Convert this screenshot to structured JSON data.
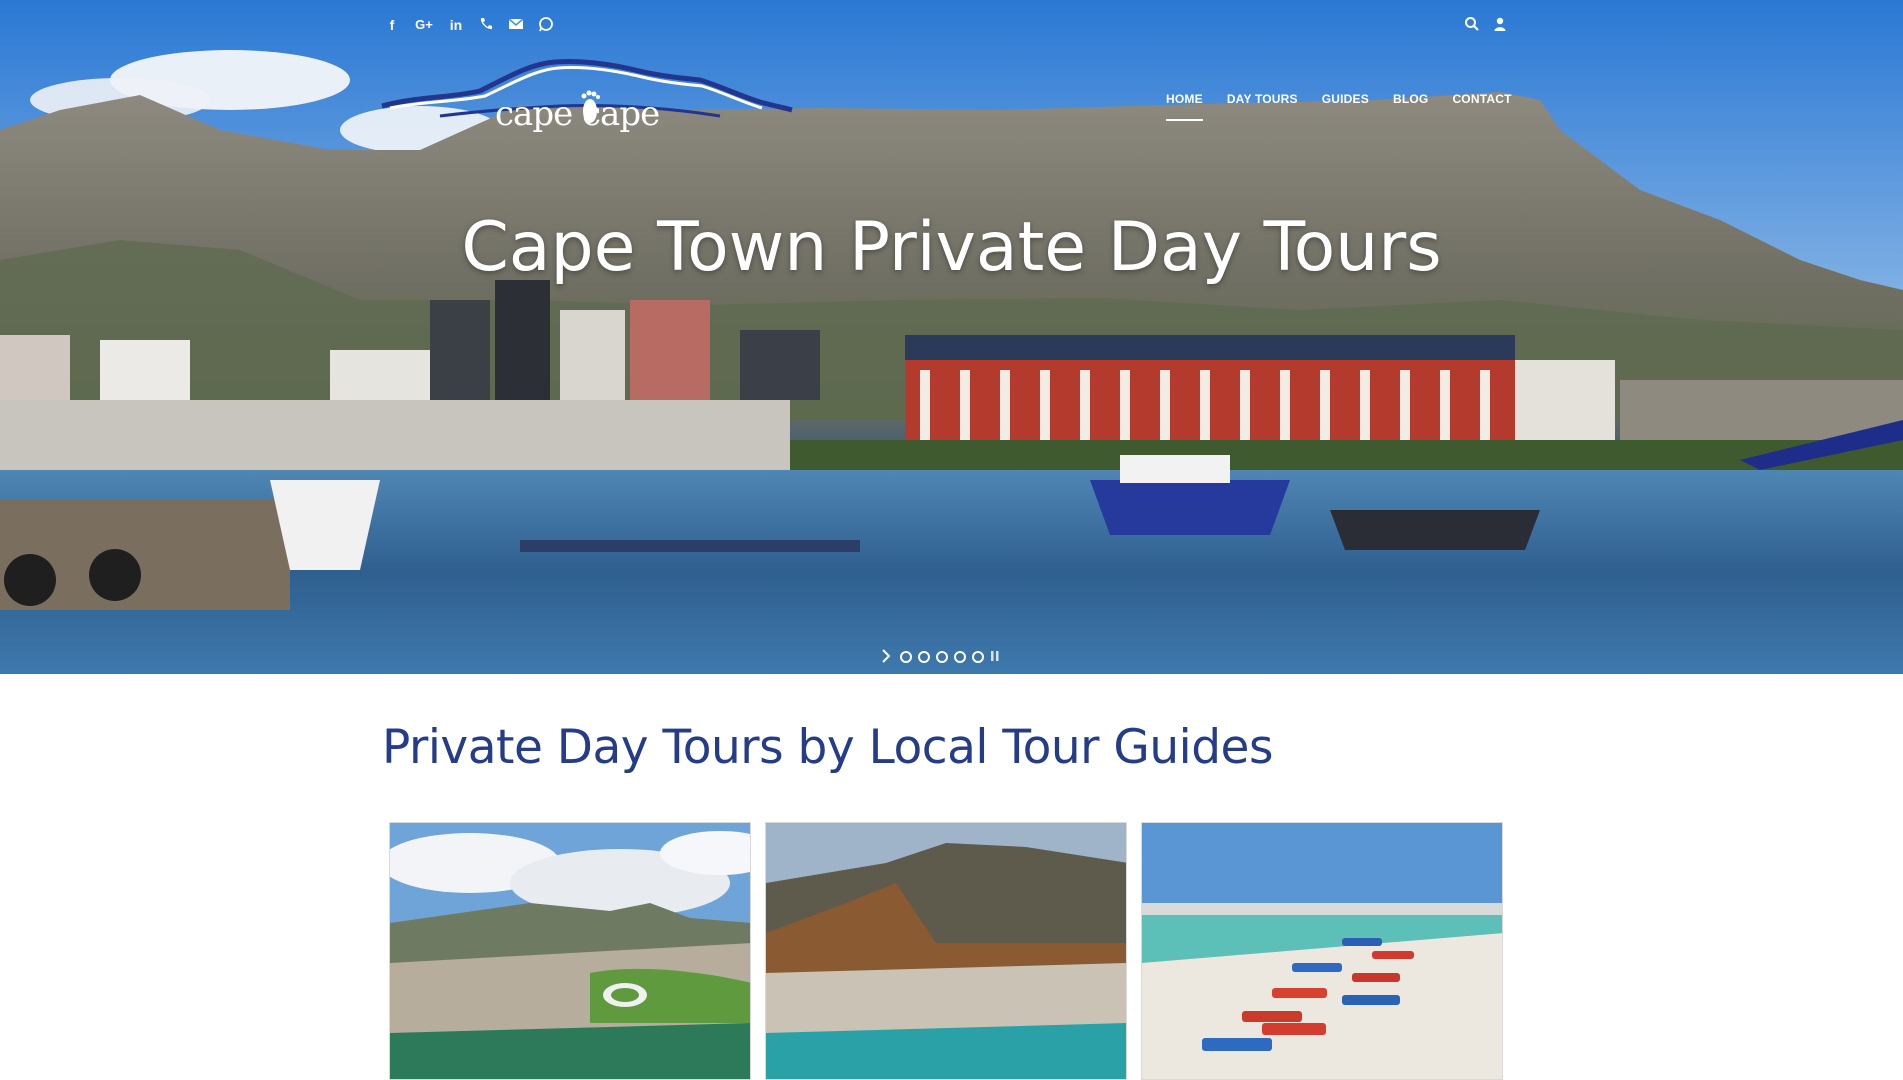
{
  "social": {
    "icons": [
      "facebook-icon",
      "google-plus-icon",
      "linkedin-icon",
      "phone-icon",
      "email-icon",
      "whatsapp-icon"
    ]
  },
  "utility": {
    "icons": [
      "search-icon",
      "user-icon"
    ]
  },
  "logo": {
    "text": "cape cape"
  },
  "nav": {
    "items": [
      {
        "label": "HOME",
        "active": true
      },
      {
        "label": "DAY TOURS",
        "active": false
      },
      {
        "label": "GUIDES",
        "active": false
      },
      {
        "label": "BLOG",
        "active": false
      },
      {
        "label": "CONTACT",
        "active": false
      }
    ]
  },
  "hero": {
    "title": "Cape Town Private Day Tours",
    "slide_count": 5
  },
  "section": {
    "title": "Private Day Tours by Local Tour Guides"
  },
  "colors": {
    "heading_blue": "#253c8a",
    "white": "#ffffff"
  }
}
